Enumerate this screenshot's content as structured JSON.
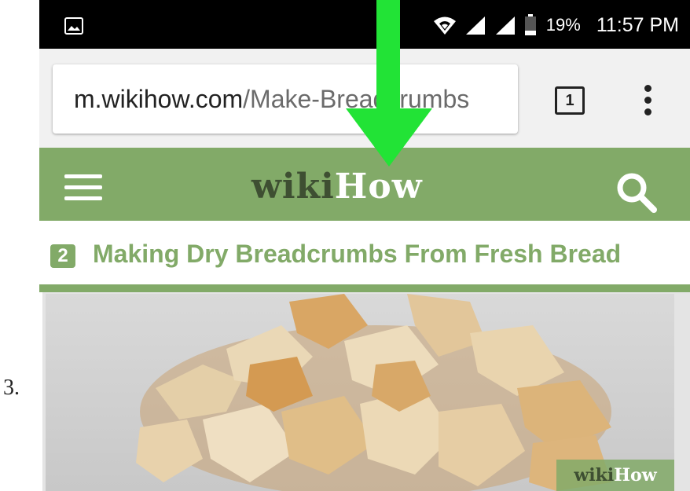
{
  "step": {
    "number": "3."
  },
  "status_bar": {
    "battery": "19%",
    "time": "11:57 PM"
  },
  "browser": {
    "url_domain": "m.wikihow.com",
    "url_path": "/Make-Breadcrumbs",
    "tab_count": "1"
  },
  "site_header": {
    "logo_wiki": "wiki",
    "logo_how": "How"
  },
  "article": {
    "section_number": "2",
    "section_title": "Making Dry Breadcrumbs From Fresh Bread",
    "image_watermark_wiki": "wiki",
    "image_watermark_how": "How"
  },
  "colors": {
    "wikihow_green": "#82aa68",
    "logo_dark": "#3e4f32",
    "annotation_arrow": "#22e336"
  }
}
